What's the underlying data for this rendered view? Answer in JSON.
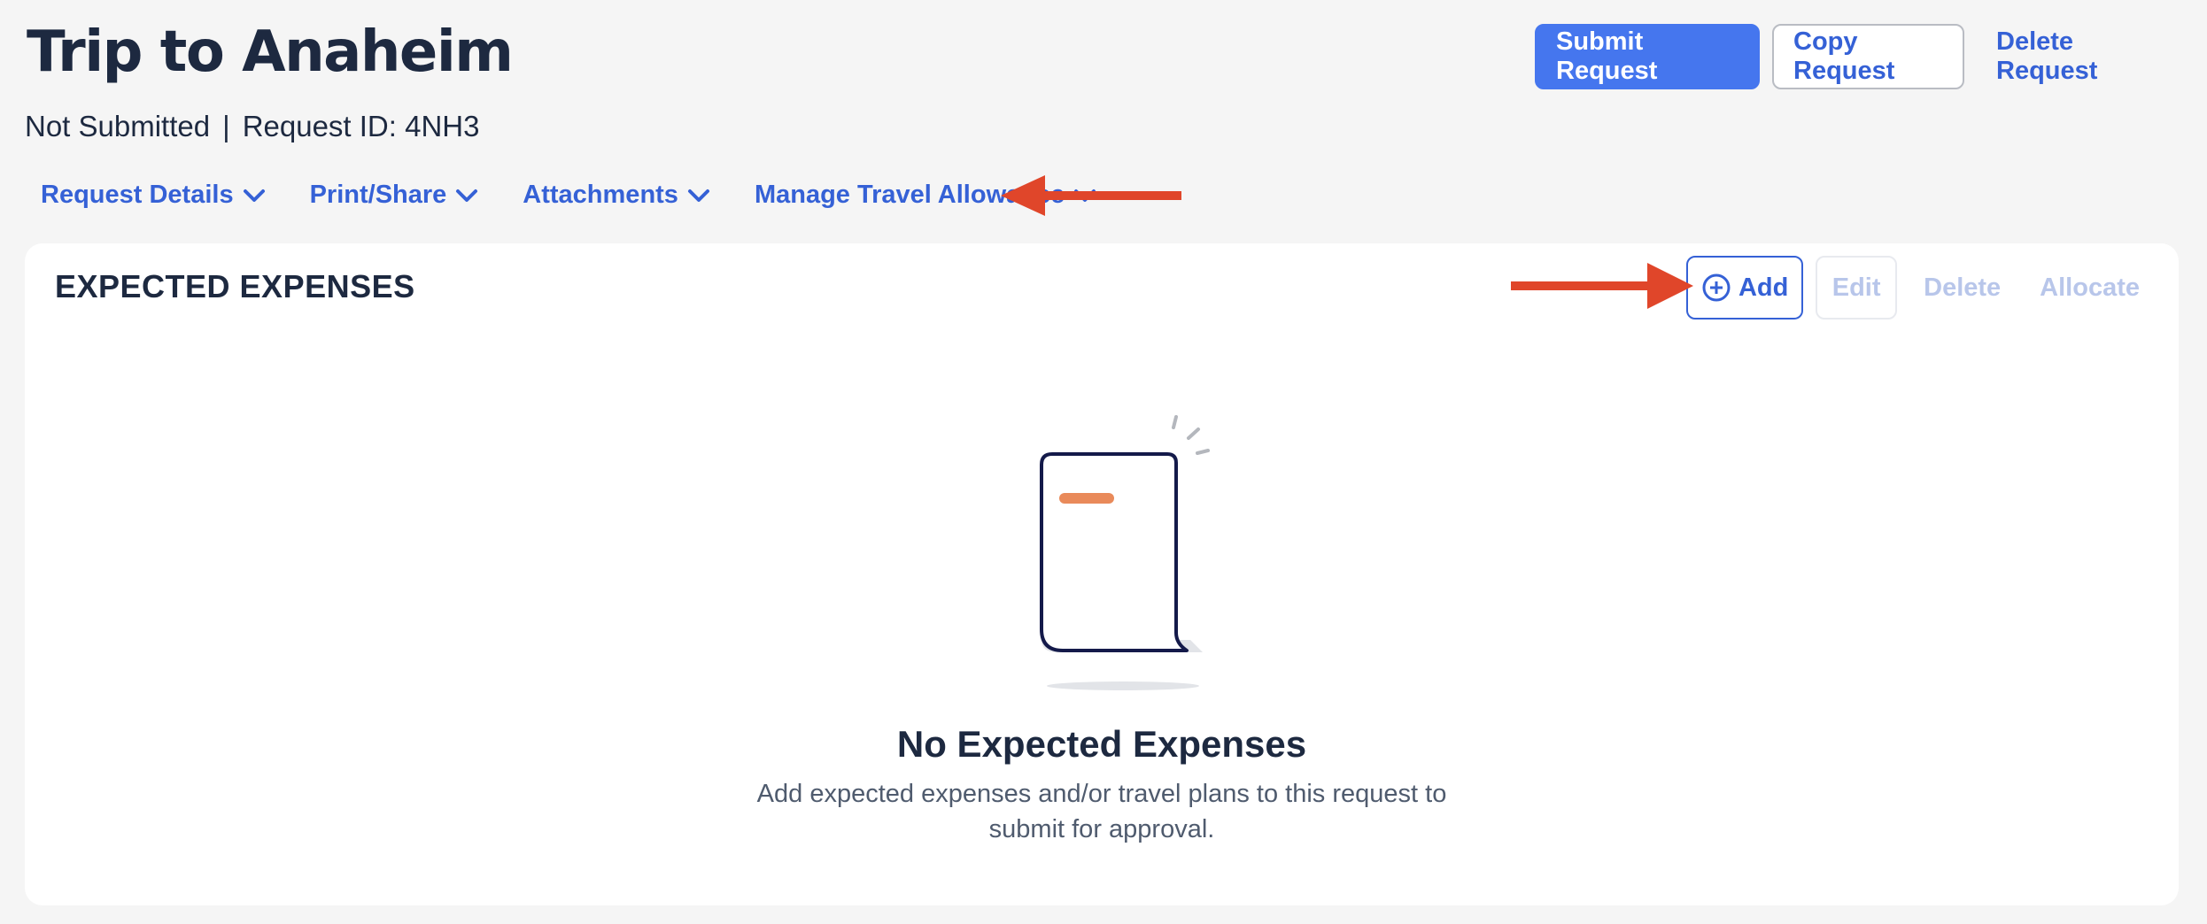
{
  "header": {
    "title": "Trip to Anaheim",
    "status": "Not Submitted",
    "separator": "|",
    "request_id": "Request ID: 4NH3",
    "actions": {
      "submit": "Submit Request",
      "copy": "Copy Request",
      "delete": "Delete Request"
    }
  },
  "menu": {
    "items": [
      {
        "label": "Request Details",
        "icon": "chevron-down-icon"
      },
      {
        "label": "Print/Share",
        "icon": "chevron-down-icon"
      },
      {
        "label": "Attachments",
        "icon": "chevron-down-icon"
      },
      {
        "label": "Manage Travel Allowance",
        "icon": "chevron-down-icon"
      }
    ]
  },
  "expenses": {
    "title": "EXPECTED EXPENSES",
    "actions": {
      "add": "Add",
      "edit": "Edit",
      "delete": "Delete",
      "allocate": "Allocate"
    },
    "empty": {
      "title": "No Expected Expenses",
      "description": "Add expected expenses and/or travel plans to this request to submit for approval."
    }
  },
  "colors": {
    "primary": "#4576ee",
    "link": "#3561d6",
    "annotation_arrow": "#e0462a",
    "disabled": "#b8c6ea"
  }
}
